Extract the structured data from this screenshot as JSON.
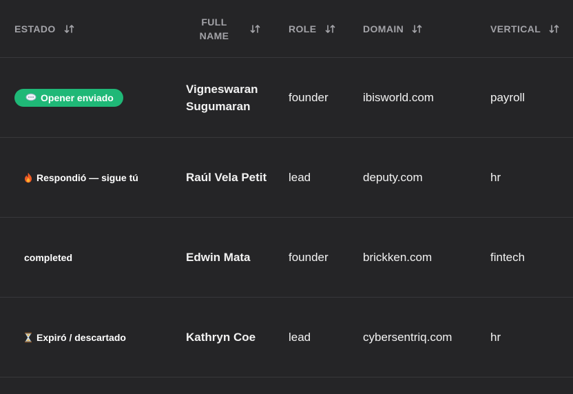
{
  "columns": [
    {
      "label": "ESTADO"
    },
    {
      "label": "FULL NAME"
    },
    {
      "label": "ROLE"
    },
    {
      "label": "DOMAIN"
    },
    {
      "label": "VERTICAL"
    }
  ],
  "rows": [
    {
      "estado": "Opener enviado",
      "estado_icon": "speech-bubble-icon",
      "name": "Vigneswaran Sugumaran",
      "role": "founder",
      "domain": "ibisworld.com",
      "vertical": "payroll"
    },
    {
      "estado": "Respondió — sigue tú",
      "estado_icon": "fire-icon",
      "name": "Raúl Vela Petit",
      "role": "lead",
      "domain": "deputy.com",
      "vertical": "hr"
    },
    {
      "estado": "completed",
      "estado_icon": "",
      "name": "Edwin Mata",
      "role": "founder",
      "domain": "brickken.com",
      "vertical": "fintech"
    },
    {
      "estado": "Expiró / descartado",
      "estado_icon": "hourglass-icon",
      "name": "Kathryn Coe",
      "role": "lead",
      "domain": "cybersentriq.com",
      "vertical": "hr"
    }
  ],
  "colors": {
    "background": "#252527",
    "header_text": "#a3a3a8",
    "divider": "#38383b",
    "badge_green": "#1fb877",
    "text": "#f2f2f2"
  }
}
